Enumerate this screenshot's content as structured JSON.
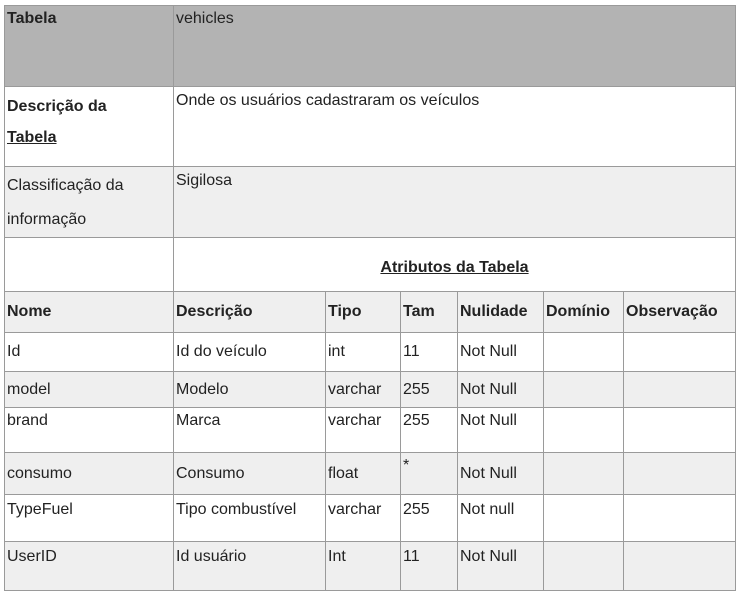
{
  "table": {
    "label": "Tabela",
    "name": "vehicles",
    "description_label_line1": "Descrição da",
    "description_label_line2": "Tabela",
    "description": "Onde os usuários cadastraram os veículos",
    "classification_label_line1": "Classificação da",
    "classification_label_line2": "informação",
    "classification": "Sigilosa",
    "attributes_title": "Atributos da Tabela"
  },
  "columns": [
    "Nome",
    "Descrição",
    "Tipo",
    "Tam",
    "Nulidade",
    "Domínio",
    "Observação"
  ],
  "rows": [
    {
      "nome": "Id",
      "descricao": "Id do veículo",
      "tipo": "int",
      "tam": "11",
      "nulidade": "Not Null",
      "dominio": "",
      "observacao": ""
    },
    {
      "nome": "model",
      "descricao": "Modelo",
      "tipo": "varchar",
      "tam": "255",
      "nulidade": "Not Null",
      "dominio": "",
      "observacao": ""
    },
    {
      "nome": "brand",
      "descricao": "Marca",
      "tipo": "varchar",
      "tam": "255",
      "nulidade": "Not Null",
      "dominio": "",
      "observacao": ""
    },
    {
      "nome": "consumo",
      "descricao": "Consumo",
      "tipo": "float",
      "tam": "*",
      "nulidade": "Not Null",
      "dominio": "",
      "observacao": ""
    },
    {
      "nome": "TypeFuel",
      "descricao": "Tipo combustível",
      "tipo": "varchar",
      "tam": "255",
      "nulidade": "Not null",
      "dominio": "",
      "observacao": ""
    },
    {
      "nome": "UserID",
      "descricao": "Id usuário",
      "tipo": "Int",
      "tam": "11",
      "nulidade": "Not Null",
      "dominio": "",
      "observacao": ""
    }
  ],
  "colors": {
    "header_bg": "#b3b3b3",
    "alt_row_bg": "#efefef",
    "border": "#9a9a9a"
  }
}
